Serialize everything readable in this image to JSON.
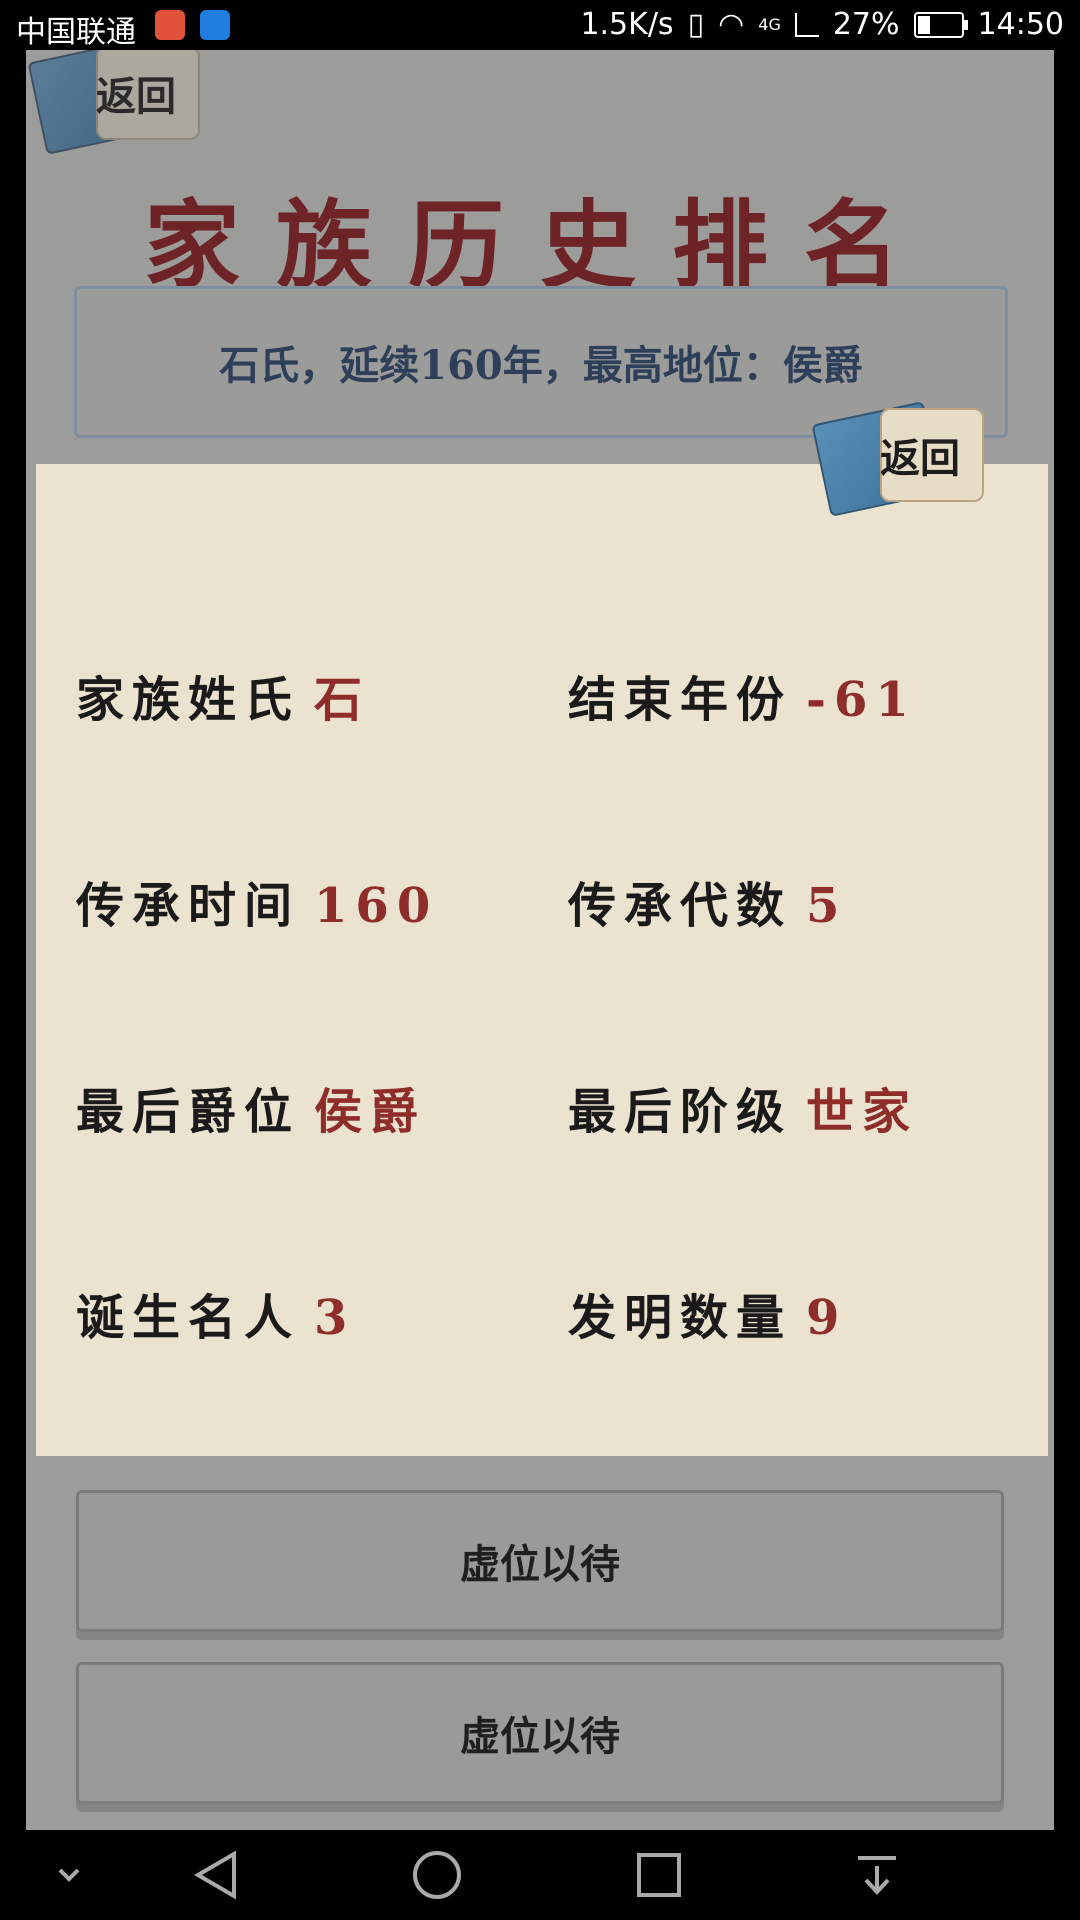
{
  "status_bar": {
    "carrier": "中国联通",
    "net_speed": "1.5K/s",
    "network": "4G",
    "battery": "27%",
    "time": "14:50"
  },
  "header": {
    "back_label": "返回",
    "title": "家族历史排名"
  },
  "summary": {
    "text": "石氏，延续160年，最高地位：侯爵"
  },
  "dialog": {
    "back_label": "返回",
    "items": [
      {
        "label": "家族姓氏",
        "value": "石"
      },
      {
        "label": "结束年份",
        "value": "-61"
      },
      {
        "label": "传承时间",
        "value": "160"
      },
      {
        "label": "传承代数",
        "value": "5"
      },
      {
        "label": "最后爵位",
        "value": "侯爵"
      },
      {
        "label": "最后阶级",
        "value": "世家"
      },
      {
        "label": "诞生名人",
        "value": "3"
      },
      {
        "label": "发明数量",
        "value": "9"
      }
    ]
  },
  "slots": [
    {
      "label": "虚位以待"
    },
    {
      "label": "虚位以待"
    }
  ],
  "nav": {
    "icons": [
      "chevron-down-icon",
      "back-triangle-icon",
      "home-circle-icon",
      "recents-square-icon",
      "notification-pull-icon"
    ]
  }
}
